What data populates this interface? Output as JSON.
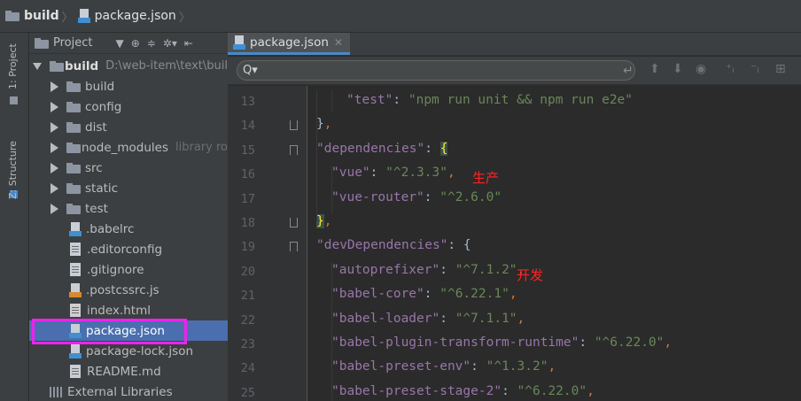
{
  "breadcrumb": {
    "folder": "build",
    "file": "package.json"
  },
  "tool_strip": {
    "project_tab": "1: Project",
    "structure_tab": "Z: Structure"
  },
  "project_panel": {
    "view_label": "Project",
    "root": {
      "name": "build",
      "path": "D:\\web-item\\text\\buil"
    },
    "items": [
      {
        "name": "build",
        "type": "folder"
      },
      {
        "name": "config",
        "type": "folder"
      },
      {
        "name": "dist",
        "type": "folder"
      },
      {
        "name": "node_modules",
        "type": "folder",
        "note": "library ro"
      },
      {
        "name": "src",
        "type": "folder"
      },
      {
        "name": "static",
        "type": "folder"
      },
      {
        "name": "test",
        "type": "folder"
      },
      {
        "name": ".babelrc",
        "type": "json"
      },
      {
        "name": ".editorconfig",
        "type": "file"
      },
      {
        "name": ".gitignore",
        "type": "file"
      },
      {
        "name": ".postcssrc.js",
        "type": "js"
      },
      {
        "name": "index.html",
        "type": "html"
      },
      {
        "name": "package.json",
        "type": "json",
        "selected": true
      },
      {
        "name": "package-lock.json",
        "type": "json"
      },
      {
        "name": "README.md",
        "type": "file"
      }
    ],
    "external_libraries": "External Libraries"
  },
  "editor": {
    "tab_label": "package.json",
    "lines": [
      {
        "n": "13",
        "indent": 2,
        "parts": [
          [
            "key",
            "\"test\""
          ],
          [
            "brace",
            ": "
          ],
          [
            "str",
            "\"npm run unit && npm run e2e\""
          ]
        ]
      },
      {
        "n": "14",
        "indent": 0,
        "parts": [
          [
            "brace",
            "}"
          ],
          [
            "punc",
            ","
          ]
        ]
      },
      {
        "n": "15",
        "indent": 0,
        "parts": [
          [
            "key",
            "\"dependencies\""
          ],
          [
            "brace",
            ": "
          ],
          [
            "brace-hl",
            "{"
          ]
        ]
      },
      {
        "n": "16",
        "indent": 1,
        "parts": [
          [
            "key",
            "\"vue\""
          ],
          [
            "brace",
            ": "
          ],
          [
            "str",
            "\"^2.3.3\""
          ],
          [
            "punc",
            ","
          ]
        ]
      },
      {
        "n": "17",
        "indent": 1,
        "parts": [
          [
            "key",
            "\"vue-router\""
          ],
          [
            "brace",
            ": "
          ],
          [
            "str",
            "\"^2.6.0\""
          ]
        ]
      },
      {
        "n": "18",
        "indent": 0,
        "parts": [
          [
            "brace-hl",
            "}"
          ],
          [
            "punc",
            ","
          ]
        ]
      },
      {
        "n": "19",
        "indent": 0,
        "parts": [
          [
            "key",
            "\"devDependencies\""
          ],
          [
            "brace",
            ": {"
          ]
        ]
      },
      {
        "n": "20",
        "indent": 1,
        "parts": [
          [
            "key",
            "\"autoprefixer\""
          ],
          [
            "brace",
            ": "
          ],
          [
            "str",
            "\"^7.1.2\""
          ],
          [
            "punc",
            ","
          ]
        ]
      },
      {
        "n": "21",
        "indent": 1,
        "parts": [
          [
            "key",
            "\"babel-core\""
          ],
          [
            "brace",
            ": "
          ],
          [
            "str",
            "\"^6.22.1\""
          ],
          [
            "punc",
            ","
          ]
        ]
      },
      {
        "n": "22",
        "indent": 1,
        "parts": [
          [
            "key",
            "\"babel-loader\""
          ],
          [
            "brace",
            ": "
          ],
          [
            "str",
            "\"^7.1.1\""
          ],
          [
            "punc",
            ","
          ]
        ]
      },
      {
        "n": "23",
        "indent": 1,
        "parts": [
          [
            "key",
            "\"babel-plugin-transform-runtime\""
          ],
          [
            "brace",
            ": "
          ],
          [
            "str",
            "\"^6.22.0\""
          ],
          [
            "punc",
            ","
          ]
        ]
      },
      {
        "n": "24",
        "indent": 1,
        "parts": [
          [
            "key",
            "\"babel-preset-env\""
          ],
          [
            "brace",
            ": "
          ],
          [
            "str",
            "\"^1.3.2\""
          ],
          [
            "punc",
            ","
          ]
        ]
      },
      {
        "n": "25",
        "indent": 1,
        "parts": [
          [
            "key",
            "\"babel-preset-stage-2\""
          ],
          [
            "brace",
            ": "
          ],
          [
            "str",
            "\"^6.22.0\""
          ],
          [
            "punc",
            ","
          ]
        ]
      }
    ],
    "annotations": {
      "production": "生产",
      "development": "开发"
    }
  },
  "colors": {
    "selection": "#4b6eaf",
    "highlight_box": "#ee22ee",
    "annotation": "#ff2222",
    "key": "#9876aa",
    "string": "#6a8759"
  }
}
